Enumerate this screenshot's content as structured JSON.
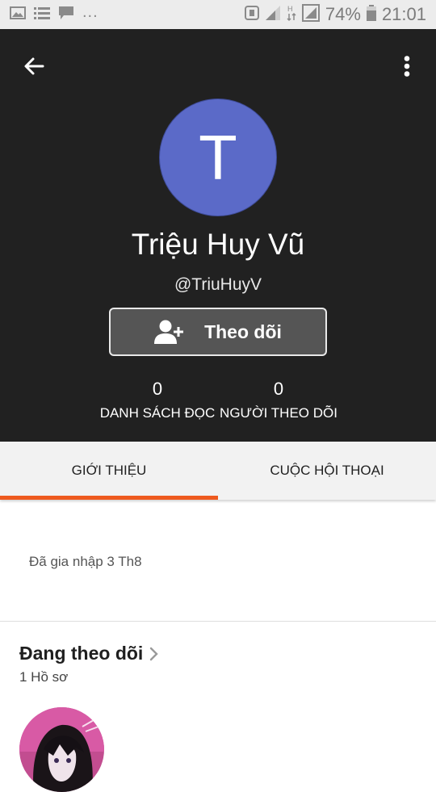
{
  "status_bar": {
    "battery": "74%",
    "time": "21:01",
    "more": "..."
  },
  "toolbar": {
    "back_icon": "arrow-left-icon",
    "menu_icon": "more-vertical-icon"
  },
  "profile": {
    "avatar_letter": "T",
    "avatar_color": "#5b6ac8",
    "display_name": "Triệu Huy Vũ",
    "username": "@TriuHuyV",
    "follow_label": "Theo dõi",
    "stats": [
      {
        "count": "0",
        "label": "DANH SÁCH ĐỌC"
      },
      {
        "count": "0",
        "label": "NGƯỜI THEO DÕI"
      }
    ]
  },
  "tabs": [
    {
      "label": "GIỚI THIỆU",
      "active": true
    },
    {
      "label": "CUỘC HỘI THOẠI",
      "active": false
    }
  ],
  "colors": {
    "header_bg": "#212121",
    "accent": "#ee5a1f"
  },
  "about": {
    "joined": "Đã gia nhập 3 Th8"
  },
  "following": {
    "title": "Đang theo dõi",
    "count": "1 Hồ sơ"
  }
}
